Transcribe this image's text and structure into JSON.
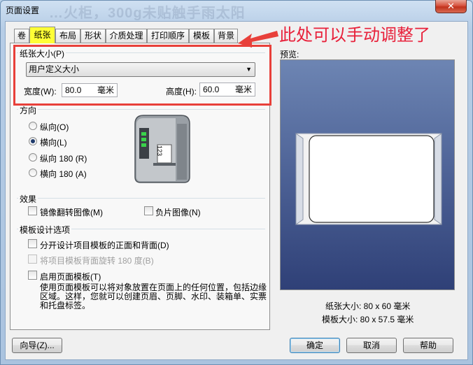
{
  "window": {
    "title": "页面设置",
    "title_background_text": "…火柜，300g未贴触手雨太阳",
    "close_symbol": "✕"
  },
  "tabs": [
    {
      "label": "卷"
    },
    {
      "label": "纸张",
      "active": true
    },
    {
      "label": "布局"
    },
    {
      "label": "形状"
    },
    {
      "label": "介质处理"
    },
    {
      "label": "打印顺序"
    },
    {
      "label": "模板"
    },
    {
      "label": "背景"
    }
  ],
  "annotation": {
    "text": "此处可以手动调整了",
    "color": "#e8203a"
  },
  "paper_size": {
    "group_label": "纸张大小(P)",
    "selected": "用户定义大小",
    "width_label": "宽度(W):",
    "width_value": "80.0",
    "width_unit": "毫米",
    "height_label": "高度(H):",
    "height_value": "60.0",
    "height_unit": "毫米"
  },
  "orientation": {
    "group_label": "方向",
    "options": [
      {
        "label": "纵向(O)",
        "selected": false
      },
      {
        "label": "横向(L)",
        "selected": true
      },
      {
        "label": "纵向 180 (R)",
        "selected": false
      },
      {
        "label": "横向 180 (A)",
        "selected": false
      }
    ],
    "printer_label_text": "123"
  },
  "effects": {
    "group_label": "效果",
    "mirror": "镜像翻转图像(M)",
    "negative": "负片图像(N)"
  },
  "template_options": {
    "group_label": "模板设计选项",
    "separate": "分开设计项目模板的正面和背面(D)",
    "rotate_back": "将项目模板背面旋转 180 度(B)",
    "enable_page_template": "启用页面模板(T)",
    "description": "使用页面模板可以将对象放置在页面上的任何位置，包括边缘区域。这样，您就可以创建页眉、页脚、水印、装箱单、实票和托盘标签。"
  },
  "preview": {
    "label": "预览:",
    "paper_size_text": "纸张大小: 80 x 60 毫米",
    "template_size_text": "模板大小: 80 x 57.5 毫米"
  },
  "buttons": {
    "wizard": "向导(Z)...",
    "ok": "确定",
    "cancel": "取消",
    "help": "帮助"
  }
}
